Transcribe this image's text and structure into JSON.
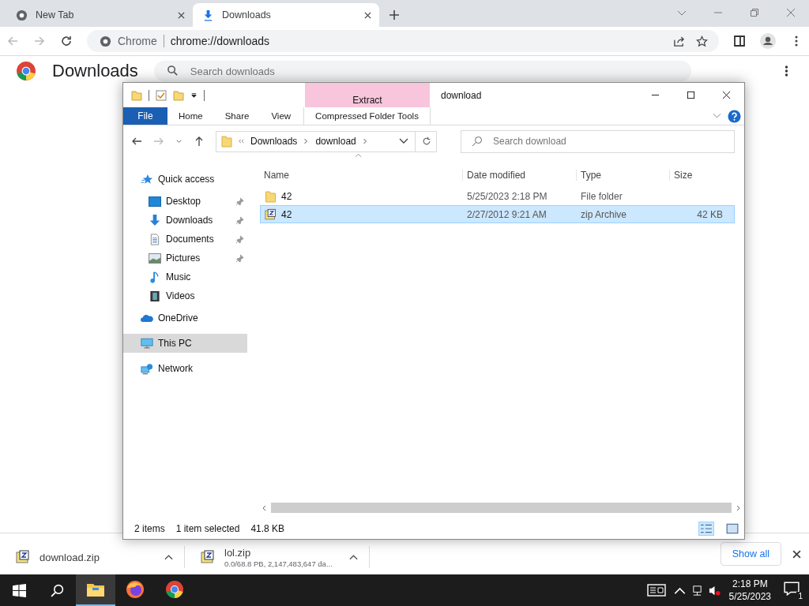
{
  "browser": {
    "tabs": [
      {
        "title": "New Tab",
        "kind": "newtab",
        "selected": false
      },
      {
        "title": "Downloads",
        "kind": "downloads",
        "selected": true
      }
    ],
    "omnibox": {
      "site": "Chrome",
      "url": "chrome://downloads"
    }
  },
  "page": {
    "title": "Downloads",
    "search_placeholder": "Search downloads"
  },
  "explorer": {
    "title": "download",
    "context_tab": "Extract",
    "file_menu": "File",
    "ribbon_tabs": [
      {
        "label": "Home",
        "kind": "plain"
      },
      {
        "label": "Share",
        "kind": "plain"
      },
      {
        "label": "View",
        "kind": "plain"
      },
      {
        "label": "Compressed Folder Tools",
        "kind": "context"
      }
    ],
    "breadcrumb": [
      "Downloads",
      "download"
    ],
    "search_placeholder": "Search download",
    "columns": [
      "Name",
      "Date modified",
      "Type",
      "Size"
    ],
    "rows": [
      {
        "kind": "folder",
        "name": "42",
        "date": "5/25/2023 2:18 PM",
        "type": "File folder",
        "selected": false
      },
      {
        "kind": "zip",
        "name": "42",
        "date": "2/27/2012 9:21 AM",
        "type": "zip Archive",
        "size": "42 KB",
        "selected": true
      }
    ],
    "nav": [
      {
        "kind": "star",
        "label": "Quick access",
        "selected": false,
        "children": [
          {
            "kind": "desktop",
            "label": "Desktop",
            "pinned": true,
            "selected": false
          },
          {
            "kind": "downloads",
            "label": "Downloads",
            "pinned": true,
            "selected": false
          },
          {
            "kind": "documents",
            "label": "Documents",
            "pinned": true,
            "selected": false
          },
          {
            "kind": "pictures",
            "label": "Pictures",
            "pinned": true,
            "selected": false
          },
          {
            "kind": "music",
            "label": "Music",
            "pinned": false,
            "selected": false
          },
          {
            "kind": "videos",
            "label": "Videos",
            "pinned": false,
            "selected": false
          }
        ]
      },
      {
        "kind": "cloud",
        "label": "OneDrive",
        "selected": false
      },
      {
        "kind": "pc",
        "label": "This PC",
        "selected": true
      },
      {
        "kind": "network",
        "label": "Network",
        "selected": false
      }
    ],
    "status": {
      "count": "2 items",
      "selection": "1 item selected",
      "size": "41.8 KB"
    }
  },
  "shelf": {
    "items": [
      {
        "name": "download.zip"
      },
      {
        "name": "lol.zip",
        "detail": "0.0/68.8 PB, 2,147,483,647 da..."
      }
    ],
    "show_all": "Show all"
  },
  "taskbar": {
    "apps": [
      {
        "kind": "explorer",
        "active": true
      },
      {
        "kind": "firefox",
        "active": false
      },
      {
        "kind": "chrome",
        "active": false
      }
    ],
    "time": "2:18 PM",
    "date": "5/25/2023",
    "notifications": "1"
  }
}
